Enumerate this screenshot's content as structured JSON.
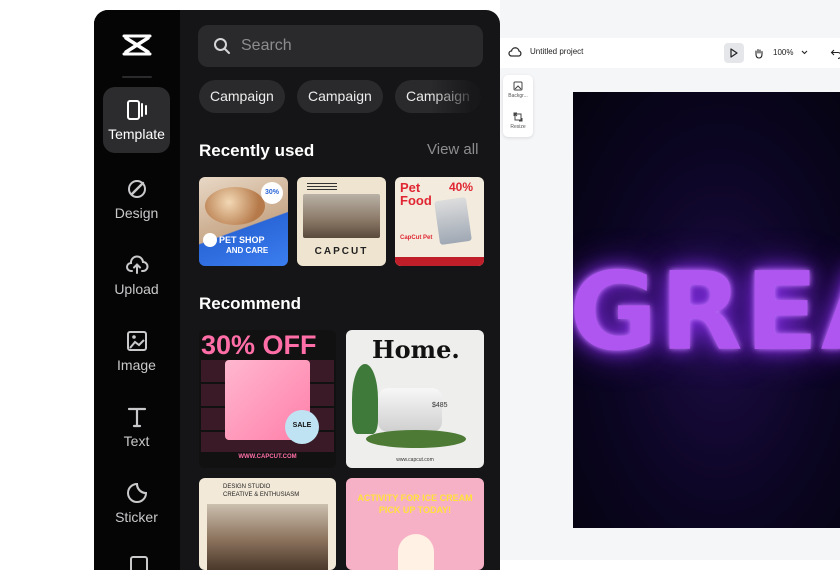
{
  "nav": [
    {
      "label": "Template",
      "icon": "template-icon",
      "active": true
    },
    {
      "label": "Design",
      "icon": "design-icon"
    },
    {
      "label": "Upload",
      "icon": "upload-icon"
    },
    {
      "label": "Image",
      "icon": "image-icon"
    },
    {
      "label": "Text",
      "icon": "text-icon"
    },
    {
      "label": "Sticker",
      "icon": "sticker-icon"
    }
  ],
  "search": {
    "placeholder": "Search"
  },
  "chips": [
    "Campaign",
    "Campaign",
    "Campaign"
  ],
  "recent": {
    "title": "Recently used",
    "view_all": "View all",
    "items": [
      {
        "line1": "PET SHOP",
        "line2": "AND CARE",
        "badge": "30%"
      },
      {
        "line1": "CAPCUT"
      },
      {
        "line1": "Pet",
        "line2": "Food",
        "badge": "40%",
        "sub": "CapCut Pet"
      }
    ]
  },
  "recommend": {
    "title": "Recommend",
    "items": [
      {
        "headline": "30% OFF",
        "tag": "SALE",
        "footer": "WWW.CAPCUT.COM"
      },
      {
        "headline": "Home.",
        "price": "$485",
        "footer": "www.capcut.com"
      },
      {
        "headline": "DESIGN STUDIO",
        "sub": "CREATIVE & ENTHUSIASM"
      },
      {
        "headline": "ACTIVITY FOR ICE CREAM",
        "sub": "PICK UP TODAY!"
      }
    ]
  },
  "editor": {
    "project_title": "Untitled project",
    "zoom": "100%",
    "side_tools": [
      {
        "label": "Backgr..."
      },
      {
        "label": "Resize"
      }
    ],
    "canvas_text": "GREAT"
  },
  "colors": {
    "panel": "#151517",
    "rail": "#050505",
    "accent": "#b056f0",
    "canvas": "#0b0522"
  }
}
